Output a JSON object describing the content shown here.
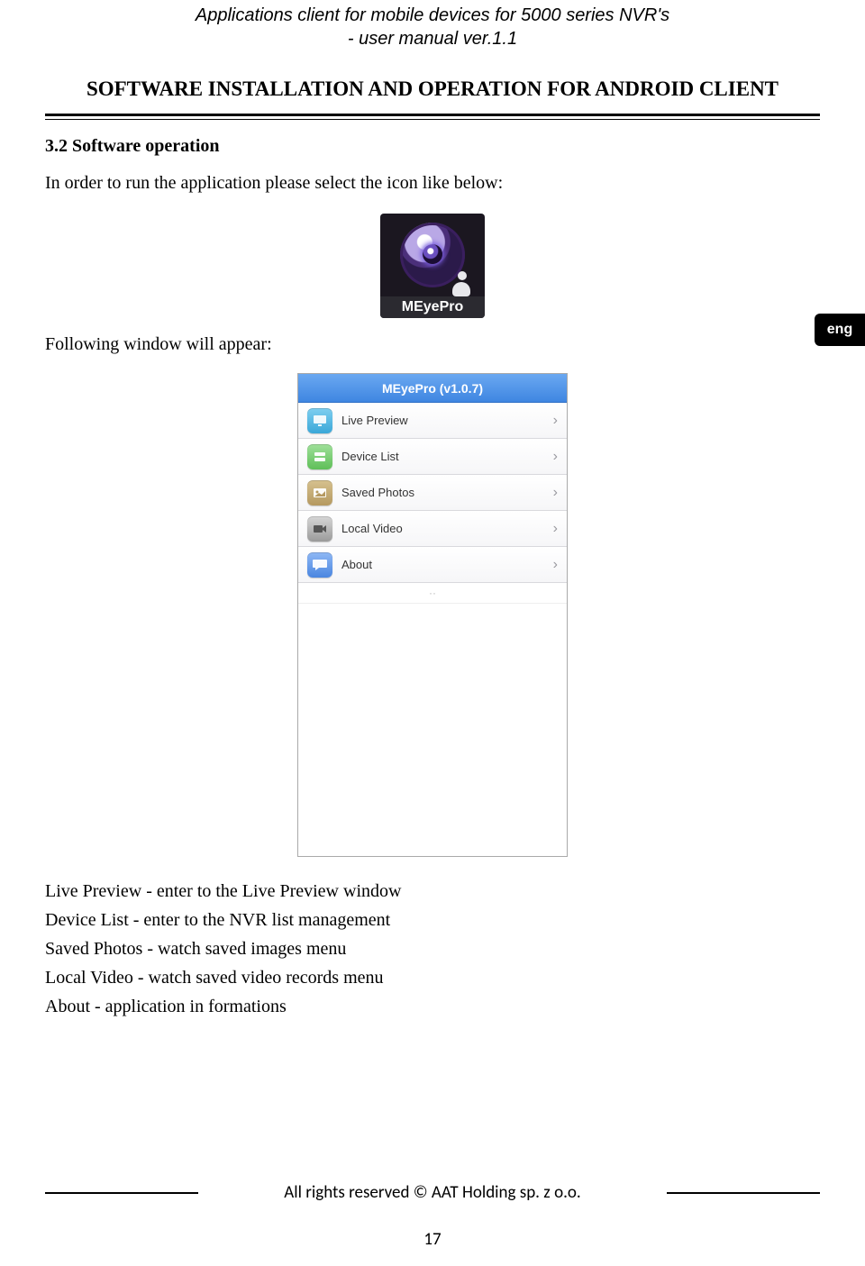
{
  "header": {
    "line1": "Applications client for mobile devices for 5000 series NVR's",
    "line2": "- user manual ver.1.1"
  },
  "chapter_title": "SOFTWARE INSTALLATION AND OPERATION FOR ANDROID CLIENT",
  "section_heading": "3.2 Software operation",
  "intro_text": "In order to run the application please select the icon like below:",
  "app_icon": {
    "label": "MEyePro",
    "semantic": "meyepro-eye-icon"
  },
  "after_icon_text": "Following window will appear:",
  "language_tab": "eng",
  "phone": {
    "title": "MEyePro (v1.0.7)",
    "items": [
      {
        "label": "Live Preview",
        "icon": "monitor-icon"
      },
      {
        "label": "Device List",
        "icon": "device-icon"
      },
      {
        "label": "Saved Photos",
        "icon": "photo-icon"
      },
      {
        "label": "Local Video",
        "icon": "video-icon"
      },
      {
        "label": "About",
        "icon": "speech-bubble-icon"
      }
    ],
    "chevron": "›"
  },
  "descriptions": [
    "Live Preview - enter to the Live Preview window",
    "Device List - enter to the NVR list management",
    "Saved Photos - watch saved images menu",
    "Local Video - watch saved video records menu",
    "About - application in formations"
  ],
  "footer": {
    "copyright": "All rights reserved © AAT Holding sp. z o.o.",
    "page_number": "17"
  }
}
